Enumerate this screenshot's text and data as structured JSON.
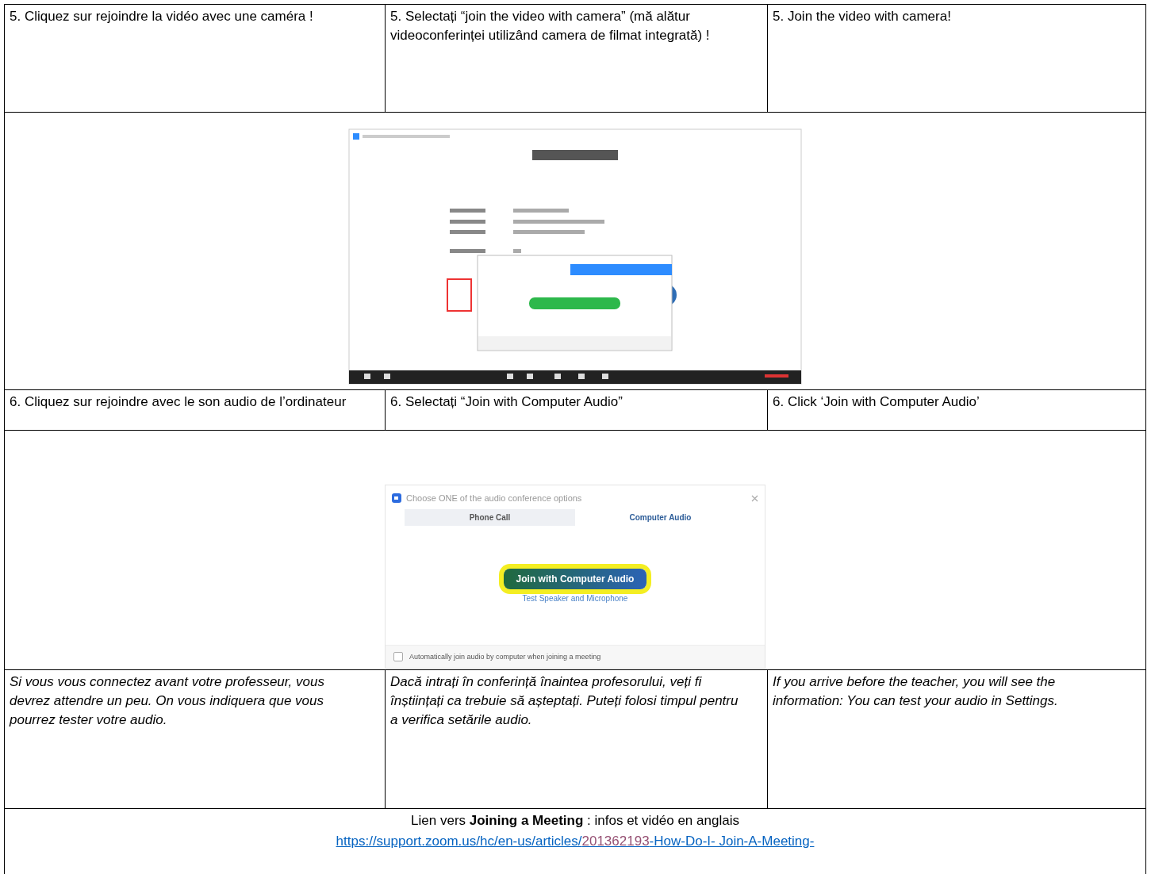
{
  "steps": [
    {
      "cells": [
        "5. Cliquez sur rejoindre la vidéo avec une caméra !",
        "5. Selectați “join the video with camera” (mă alătur videoconferinței utilizând camera de filmat integrată) !",
        "5. Join the video with camera!"
      ],
      "figure": {
        "kind": "meeting-window"
      }
    },
    {
      "cells": [
        "6. Cliquez sur rejoindre avec le son audio de l’ordinateur",
        "6. Selectați “Join with Computer Audio”",
        "6. Click ‘Join with Computer Audio’"
      ],
      "figure": {
        "kind": "audio-dialog",
        "title": "Choose ONE of the audio conference options",
        "tabs": [
          {
            "label": "Phone Call",
            "selected": false
          },
          {
            "label": "Computer Audio",
            "selected": true
          }
        ],
        "button": "Join with Computer Audio",
        "link": "Test Speaker and Microphone",
        "checkbox": {
          "label": "Automatically join audio by computer when joining a meeting",
          "checked": false
        }
      }
    }
  ],
  "notes": [
    "Si vous vous connectez avant votre professeur, vous devrez attendre un peu. On vous indiquera que vous\npourrez tester votre audio.",
    "Dacă intrați în conferință înaintea profesorului, veți fi înștiințați ca trebuie să așteptați. Puteți folosi timpul pentru a verifica setările audio.",
    "If you arrive before the teacher, you will see the information: You can test your audio in Settings."
  ],
  "footer": {
    "text": "Lien vers **Joining a Meeting** : infos et vidéo en anglais",
    "url_parts": [
      {
        "text": "https://support.zoom.us/hc/en-us/articles/",
        "visited": false
      },
      {
        "text": "201362193",
        "visited": true
      },
      {
        "text": "-How-Do-I- Join-A-Meeting-",
        "visited": false
      }
    ]
  }
}
